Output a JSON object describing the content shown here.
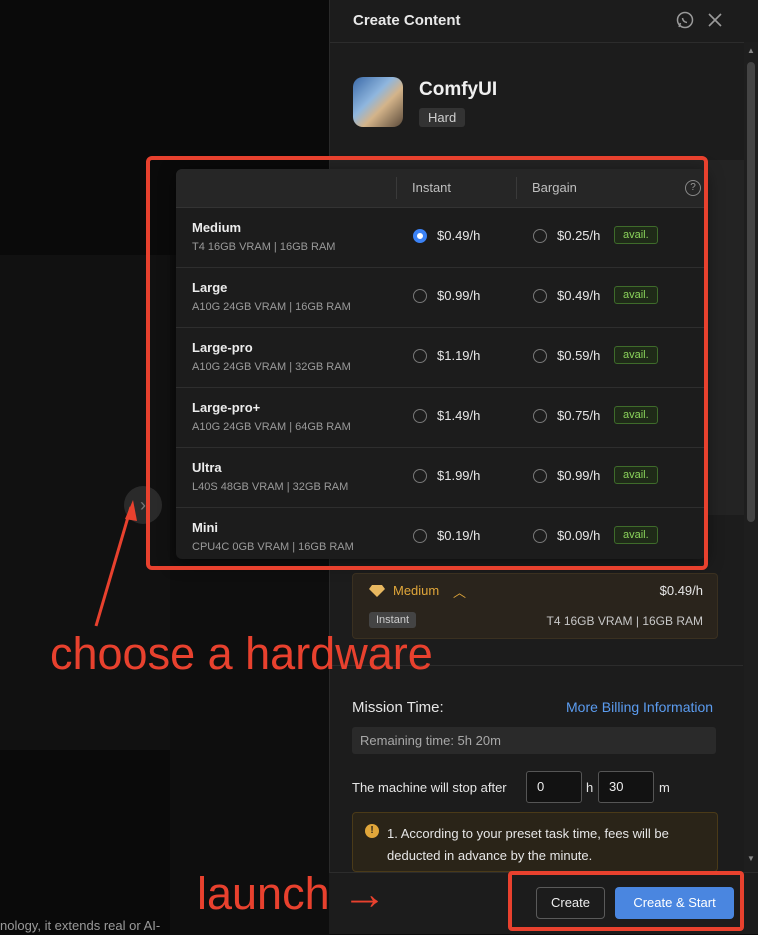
{
  "background": {
    "partial_text": "nology, it extends real or AI-"
  },
  "panel": {
    "title": "Create Content",
    "app": {
      "name": "ComfyUI",
      "difficulty": "Hard"
    }
  },
  "hardware_table": {
    "columns": {
      "instant": "Instant",
      "bargain": "Bargain"
    },
    "rows": [
      {
        "name": "Medium",
        "spec": "T4 16GB VRAM | 16GB RAM",
        "instant": "$0.49/h",
        "bargain": "$0.25/h",
        "avail": "avail.",
        "selected": true
      },
      {
        "name": "Large",
        "spec": "A10G 24GB VRAM | 16GB RAM",
        "instant": "$0.99/h",
        "bargain": "$0.49/h",
        "avail": "avail.",
        "selected": false
      },
      {
        "name": "Large-pro",
        "spec": "A10G 24GB VRAM | 32GB RAM",
        "instant": "$1.19/h",
        "bargain": "$0.59/h",
        "avail": "avail.",
        "selected": false
      },
      {
        "name": "Large-pro+",
        "spec": "A10G 24GB VRAM | 64GB RAM",
        "instant": "$1.49/h",
        "bargain": "$0.75/h",
        "avail": "avail.",
        "selected": false
      },
      {
        "name": "Ultra",
        "spec": "L40S 48GB VRAM | 32GB RAM",
        "instant": "$1.99/h",
        "bargain": "$0.99/h",
        "avail": "avail.",
        "selected": false
      },
      {
        "name": "Mini",
        "spec": "CPU4C 0GB VRAM | 16GB RAM",
        "instant": "$0.19/h",
        "bargain": "$0.09/h",
        "avail": "avail.",
        "selected": false
      }
    ]
  },
  "selection": {
    "name": "Medium",
    "price": "$0.49/h",
    "mode": "Instant",
    "spec": "T4 16GB VRAM | 16GB RAM"
  },
  "mission": {
    "label": "Mission Time:",
    "billing_link": "More Billing Information",
    "remaining": "Remaining time: 5h 20m",
    "stop_label": "The machine will stop after",
    "hours": "0",
    "hours_unit": "h",
    "minutes": "30",
    "minutes_unit": "m",
    "notice": "1. According to your preset task time, fees will be deducted in advance by the minute."
  },
  "buttons": {
    "create": "Create",
    "create_start": "Create & Start"
  },
  "annotations": {
    "hardware": "choose a hardware",
    "launch": "launch →"
  },
  "colors": {
    "accent": "#4a86e0",
    "annotation": "#e8412e",
    "avail": "#8bd35b",
    "warning": "#e0a63a"
  }
}
